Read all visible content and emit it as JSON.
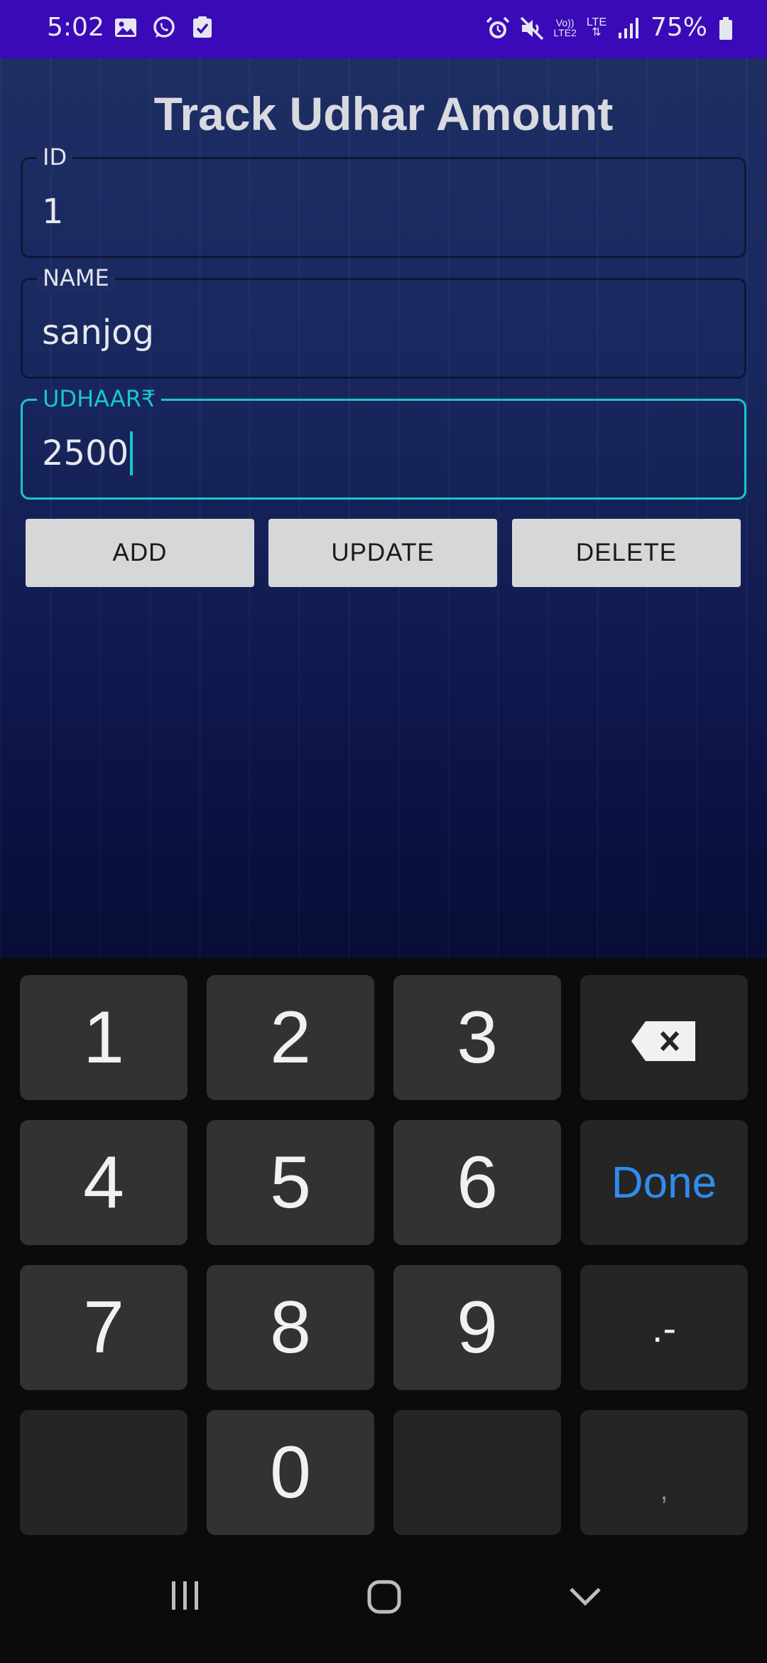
{
  "status_bar": {
    "time": "5:02",
    "battery": "75%",
    "network_top": "Vo))",
    "network_bottom": "LTE2",
    "lte": "LTE",
    "icons_left": [
      "gallery-icon",
      "whatsapp-icon",
      "task-check-icon"
    ],
    "icons_right": [
      "alarm-icon",
      "mute-icon",
      "volte-icon",
      "lte-icon",
      "signal-icon",
      "battery-icon"
    ],
    "bar_color": "#3a0ab8"
  },
  "app": {
    "title": "Track Udhar Amount",
    "fields": [
      {
        "label": "ID",
        "value": "1",
        "focused": false
      },
      {
        "label": "NAME",
        "value": "sanjog",
        "focused": false
      },
      {
        "label": "UDHAAR₹",
        "value": "2500",
        "focused": true
      }
    ],
    "buttons": [
      "ADD",
      "UPDATE",
      "DELETE"
    ],
    "accent_color": "#19c6cc"
  },
  "keyboard": {
    "rows": [
      [
        "1",
        "2",
        "3",
        "backspace"
      ],
      [
        "4",
        "5",
        "6",
        "Done"
      ],
      [
        "7",
        "8",
        "9",
        ".-"
      ],
      [
        "",
        "0",
        "",
        ","
      ]
    ],
    "done_label": "Done",
    "done_color": "#2f8cf0"
  },
  "nav_bar": {
    "icons": [
      "recent-apps-icon",
      "home-icon",
      "back-chevron-icon"
    ]
  }
}
